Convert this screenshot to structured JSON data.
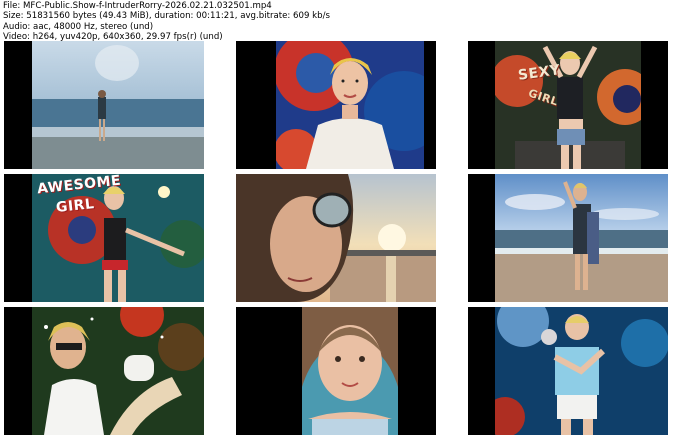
{
  "info": {
    "file": "File: MFC-Public.Show-f-IntruderRorry-2026.02.21.032501.mp4",
    "size": "Size: 51831560 bytes (49.43 MiB), duration: 00:11:21, avg.bitrate: 609 kb/s",
    "audio": "Audio: aac, 48000 Hz, stereo (und)",
    "video": "Video: h264, yuv420p, 640x360, 29.97 fps(r) (und)"
  },
  "thumbnails": [
    {
      "scene": "beach-standing-woman"
    },
    {
      "scene": "blonde-white-shirt-space-mural"
    },
    {
      "scene": "sexy-girl-mural-pose",
      "overlay_text": [
        "SEXY",
        "GIRL"
      ]
    },
    {
      "scene": "awesome-girl-corset",
      "overlay_text": [
        "AWESOME",
        "GIRL"
      ]
    },
    {
      "scene": "sunglasses-sunset-selfie"
    },
    {
      "scene": "beach-towel-woman"
    },
    {
      "scene": "sunglasses-white-top-sitting"
    },
    {
      "scene": "close-up-face-selfie"
    },
    {
      "scene": "blue-top-space-mural-pose"
    }
  ]
}
